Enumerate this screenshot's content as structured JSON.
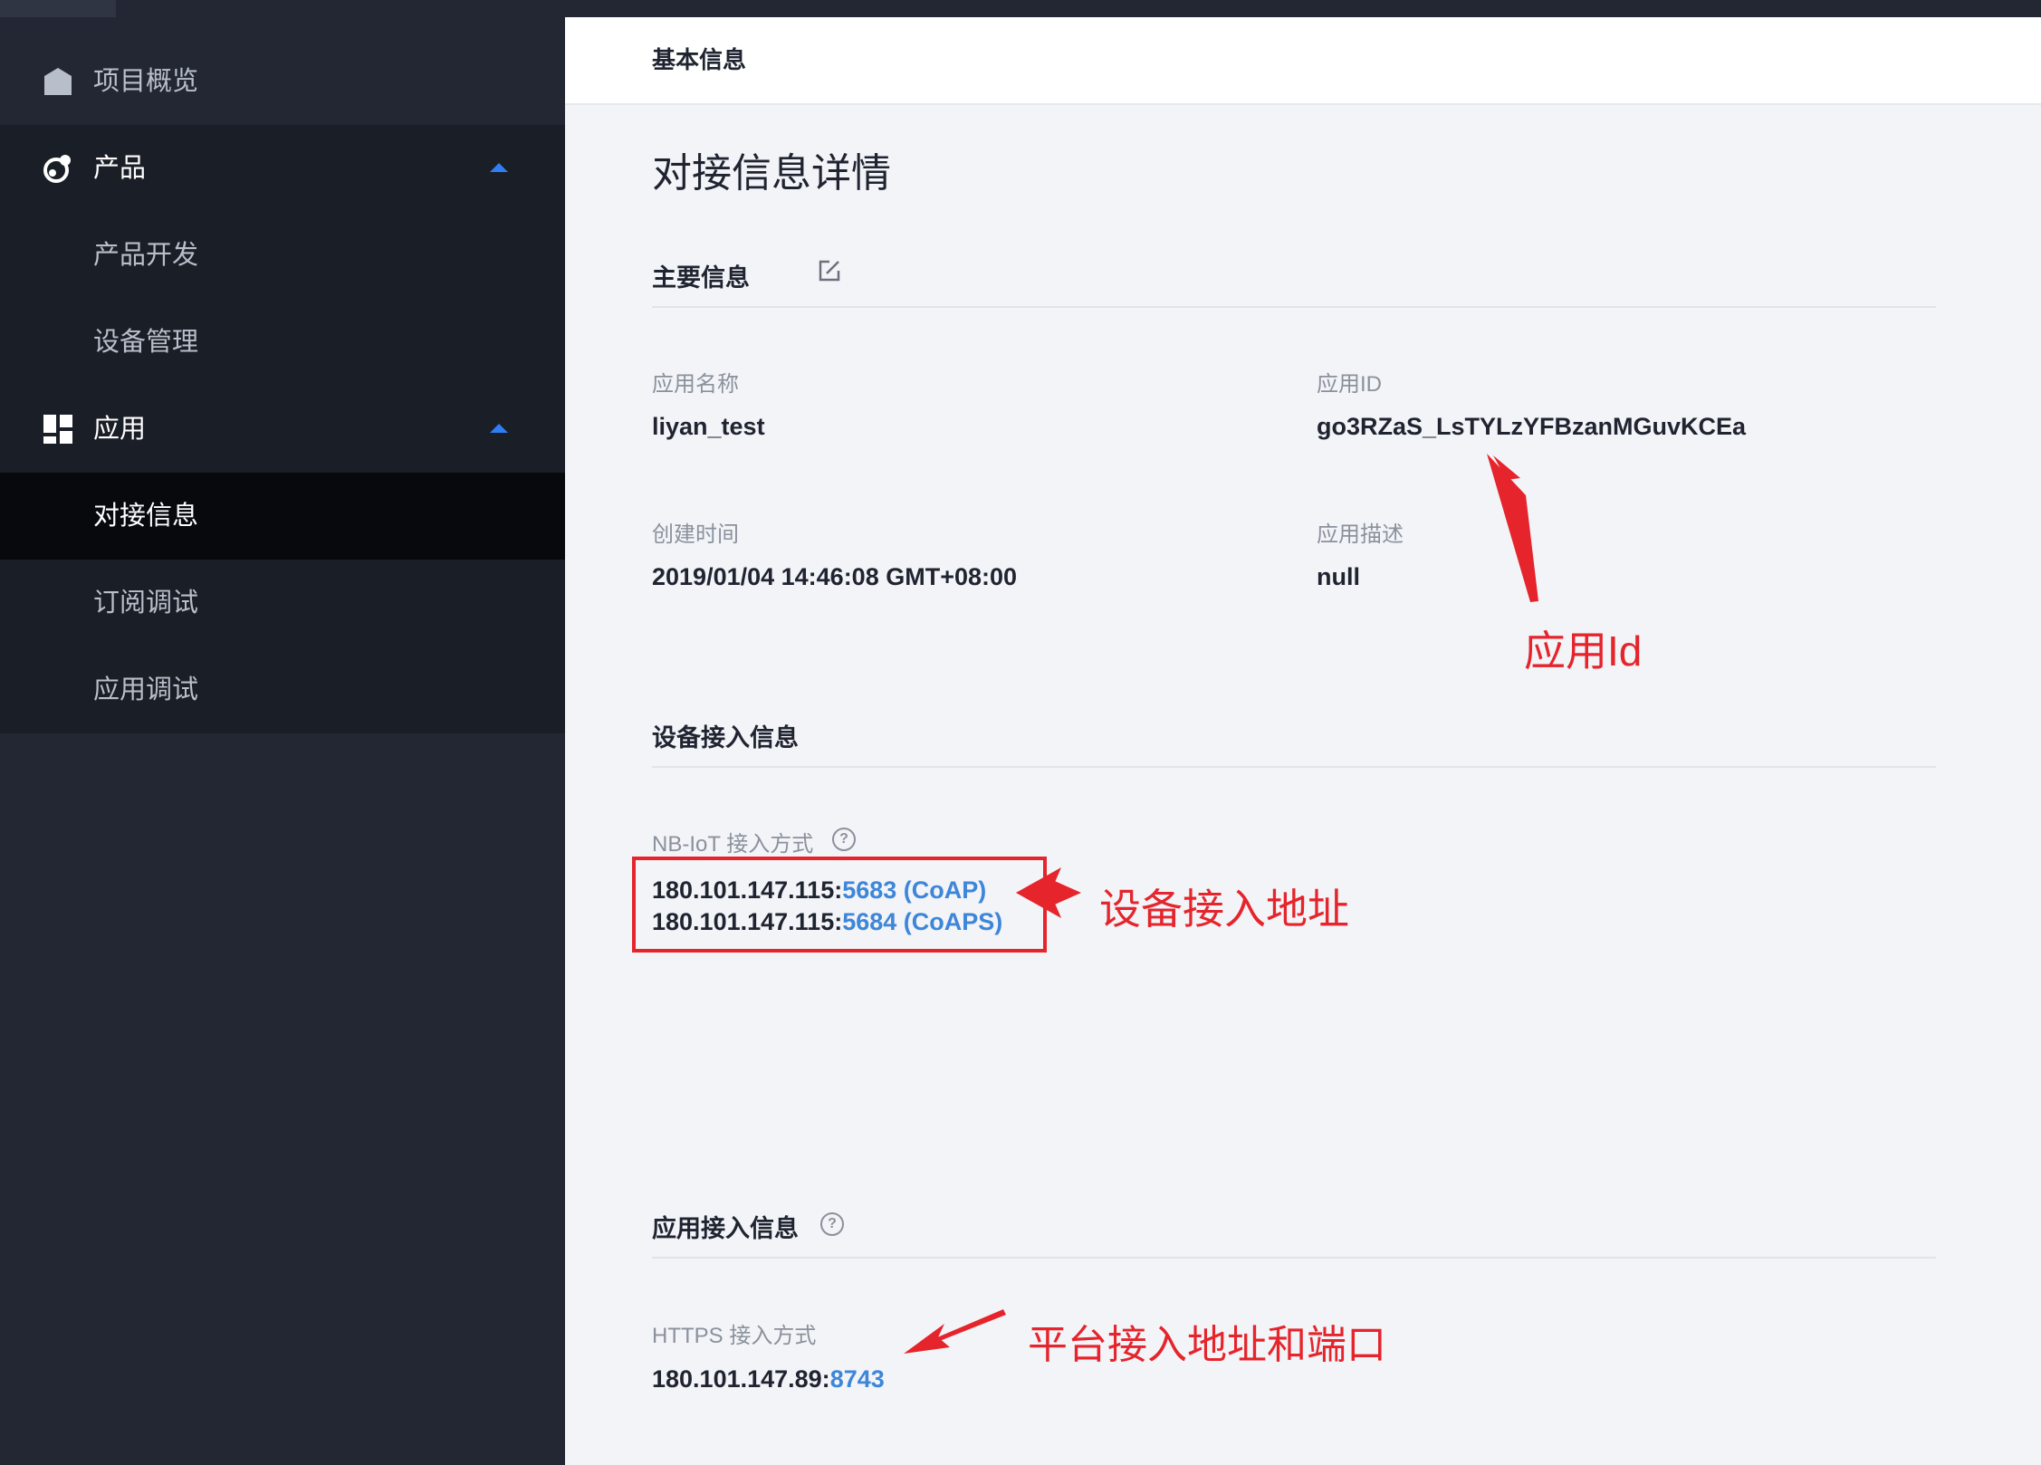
{
  "sidebar": {
    "items": [
      {
        "label": "项目概览"
      },
      {
        "label": "产品"
      },
      {
        "label": "产品开发"
      },
      {
        "label": "设备管理"
      },
      {
        "label": "应用"
      },
      {
        "label": "对接信息"
      },
      {
        "label": "订阅调试"
      },
      {
        "label": "应用调试"
      }
    ]
  },
  "header": {
    "title": "基本信息"
  },
  "page": {
    "title": "对接信息详情"
  },
  "main_info": {
    "title": "主要信息",
    "app_name_label": "应用名称",
    "app_name": "liyan_test",
    "app_id_label": "应用ID",
    "app_id": "go3RZaS_LsTYLzYFBzanMGuvKCEa",
    "created_label": "创建时间",
    "created": "2019/01/04 14:46:08 GMT+08:00",
    "desc_label": "应用描述",
    "desc": "null"
  },
  "device_access": {
    "title": "设备接入信息",
    "nb_label": "NB-IoT 接入方式",
    "host1": "180.101.147.115:",
    "port1": "5683 (CoAP)",
    "host2": "180.101.147.115:",
    "port2": "5684 (CoAPS)"
  },
  "app_access": {
    "title": "应用接入信息",
    "https_label": "HTTPS 接入方式",
    "host": "180.101.147.89:",
    "port": "8743"
  },
  "annotations": {
    "app_id": "应用Id",
    "device_addr": "设备接入地址",
    "platform_addr": "平台接入地址和端口"
  },
  "colors": {
    "accent": "#2f7ef6",
    "link": "#3d86d8",
    "annotation": "#e5242b"
  }
}
